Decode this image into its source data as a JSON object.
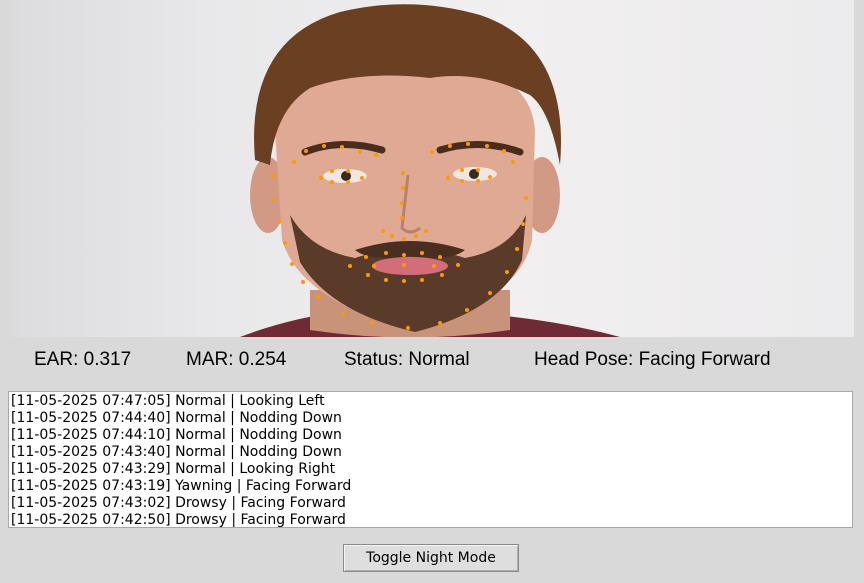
{
  "metrics": {
    "ear": "EAR: 0.317",
    "mar": "MAR: 0.254",
    "status": "Status: Normal",
    "head_pose": "Head Pose: Facing Forward"
  },
  "log": [
    "[11-05-2025 07:47:05] Normal | Looking Left",
    "[11-05-2025 07:44:40] Normal | Nodding Down",
    "[11-05-2025 07:44:10] Normal | Nodding Down",
    "[11-05-2025 07:43:40] Normal | Nodding Down",
    "[11-05-2025 07:43:29] Normal | Looking Right",
    "[11-05-2025 07:43:19] Yawning | Facing Forward",
    "[11-05-2025 07:43:02] Drowsy | Facing Forward",
    "[11-05-2025 07:42:50] Drowsy | Facing Forward"
  ],
  "controls": {
    "toggle_label": "Toggle Night Mode"
  },
  "colors": {
    "landmark": "#ff9900",
    "window_bg": "#d9d9d9"
  }
}
